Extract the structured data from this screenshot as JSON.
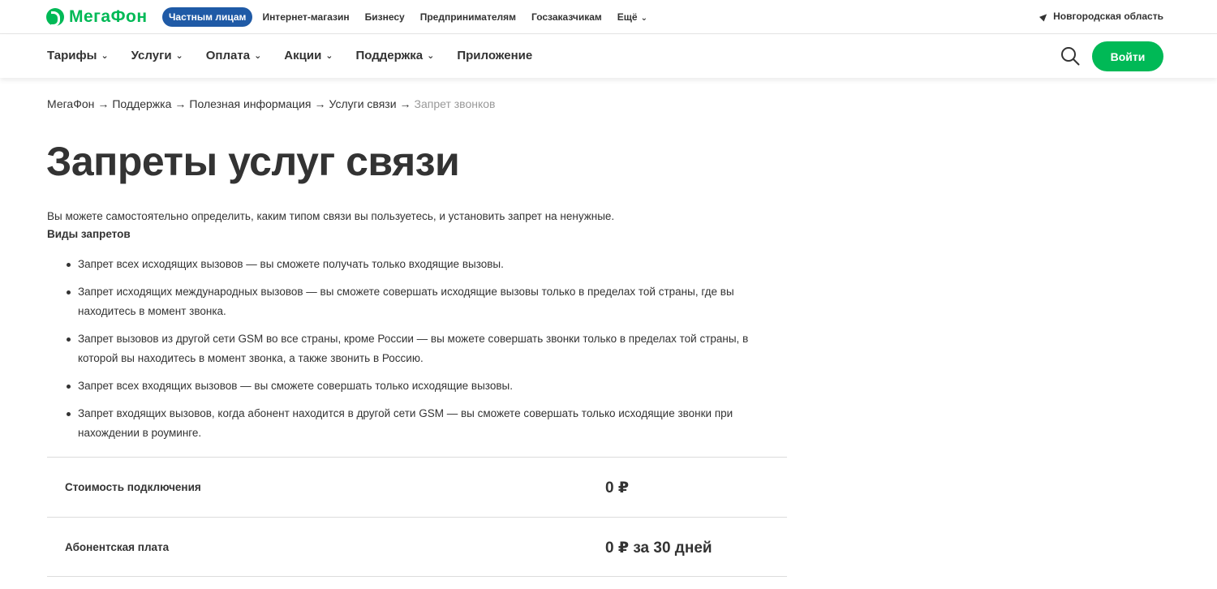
{
  "brand": {
    "logo_text": "МегаФон",
    "accent_color": "#00b956",
    "active_segment_color": "#1f5aa6"
  },
  "top_bar": {
    "segments": [
      {
        "label": "Частным лицам",
        "active": true
      },
      {
        "label": "Интернет-магазин"
      },
      {
        "label": "Бизнесу"
      },
      {
        "label": "Предпринимателям"
      },
      {
        "label": "Госзаказчикам"
      },
      {
        "label": "Ещё",
        "has_dropdown": true
      }
    ],
    "region": "Новгородская область",
    "region_icon": "location-arrow-icon"
  },
  "main_nav": {
    "items": [
      {
        "label": "Тарифы"
      },
      {
        "label": "Услуги"
      },
      {
        "label": "Оплата"
      },
      {
        "label": "Акции"
      },
      {
        "label": "Поддержка"
      },
      {
        "label": "Приложение"
      }
    ],
    "search_icon": "search-icon",
    "login_label": "Войти"
  },
  "breadcrumb": {
    "items": [
      "МегаФон",
      "Поддержка",
      "Полезная информация",
      "Услуги связи",
      "Запрет звонков"
    ],
    "separator": "→"
  },
  "page": {
    "title": "Запреты услуг связи",
    "intro": "Вы можете самостоятельно определить, каким типом связи вы пользуетесь, и установить запрет на ненужные.",
    "subheading": "Виды запретов",
    "bullets": [
      "Запрет всех исходящих вызовов — вы сможете получать только входящие вызовы.",
      "Запрет исходящих международных вызовов — вы сможете совершать исходящие вызовы только в пределах той страны, где вы находитесь в момент звонка.",
      "Запрет вызовов из другой сети GSM во все страны, кроме России — вы можете совершать звонки только в пределах той страны, в которой вы находитесь в момент звонка, а также звонить в Россию.",
      "Запрет всех входящих вызовов — вы сможете совершать только исходящие вызовы.",
      "Запрет входящих вызовов, когда абонент находится в другой сети GSM — вы сможете совершать только исходящие звонки при нахождении в роуминге."
    ]
  },
  "pricing": [
    {
      "label": "Стоимость подключения",
      "value": "0 ₽"
    },
    {
      "label": "Абонентская плата",
      "value": "0 ₽ за 30 дней"
    }
  ]
}
